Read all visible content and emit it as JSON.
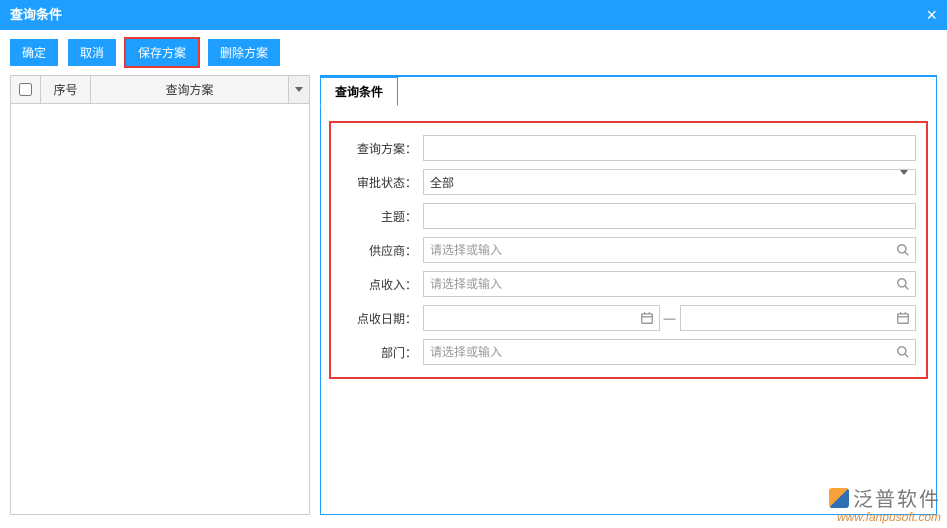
{
  "header": {
    "title": "查询条件"
  },
  "toolbar": {
    "ok": "确定",
    "cancel": "取消",
    "savePlan": "保存方案",
    "deletePlan": "删除方案"
  },
  "grid": {
    "col_seq": "序号",
    "col_plan": "查询方案"
  },
  "tab": {
    "label": "查询条件"
  },
  "form": {
    "planLabel": "查询方案：",
    "planValue": "",
    "statusLabel": "审批状态：",
    "statusValue": "全部",
    "subjectLabel": "主题：",
    "subjectValue": "",
    "supplierLabel": "供应商：",
    "supplierPh": "请选择或输入",
    "incomeLabel": "点收入：",
    "incomePh": "请选择或输入",
    "dateLabel": "点收日期：",
    "dateFrom": "",
    "dateTo": "",
    "rangeSep": "—",
    "deptLabel": "部门：",
    "deptPh": "请选择或输入"
  },
  "watermark": {
    "brand": "泛普软件",
    "url": "www.fanpusoft.com"
  }
}
